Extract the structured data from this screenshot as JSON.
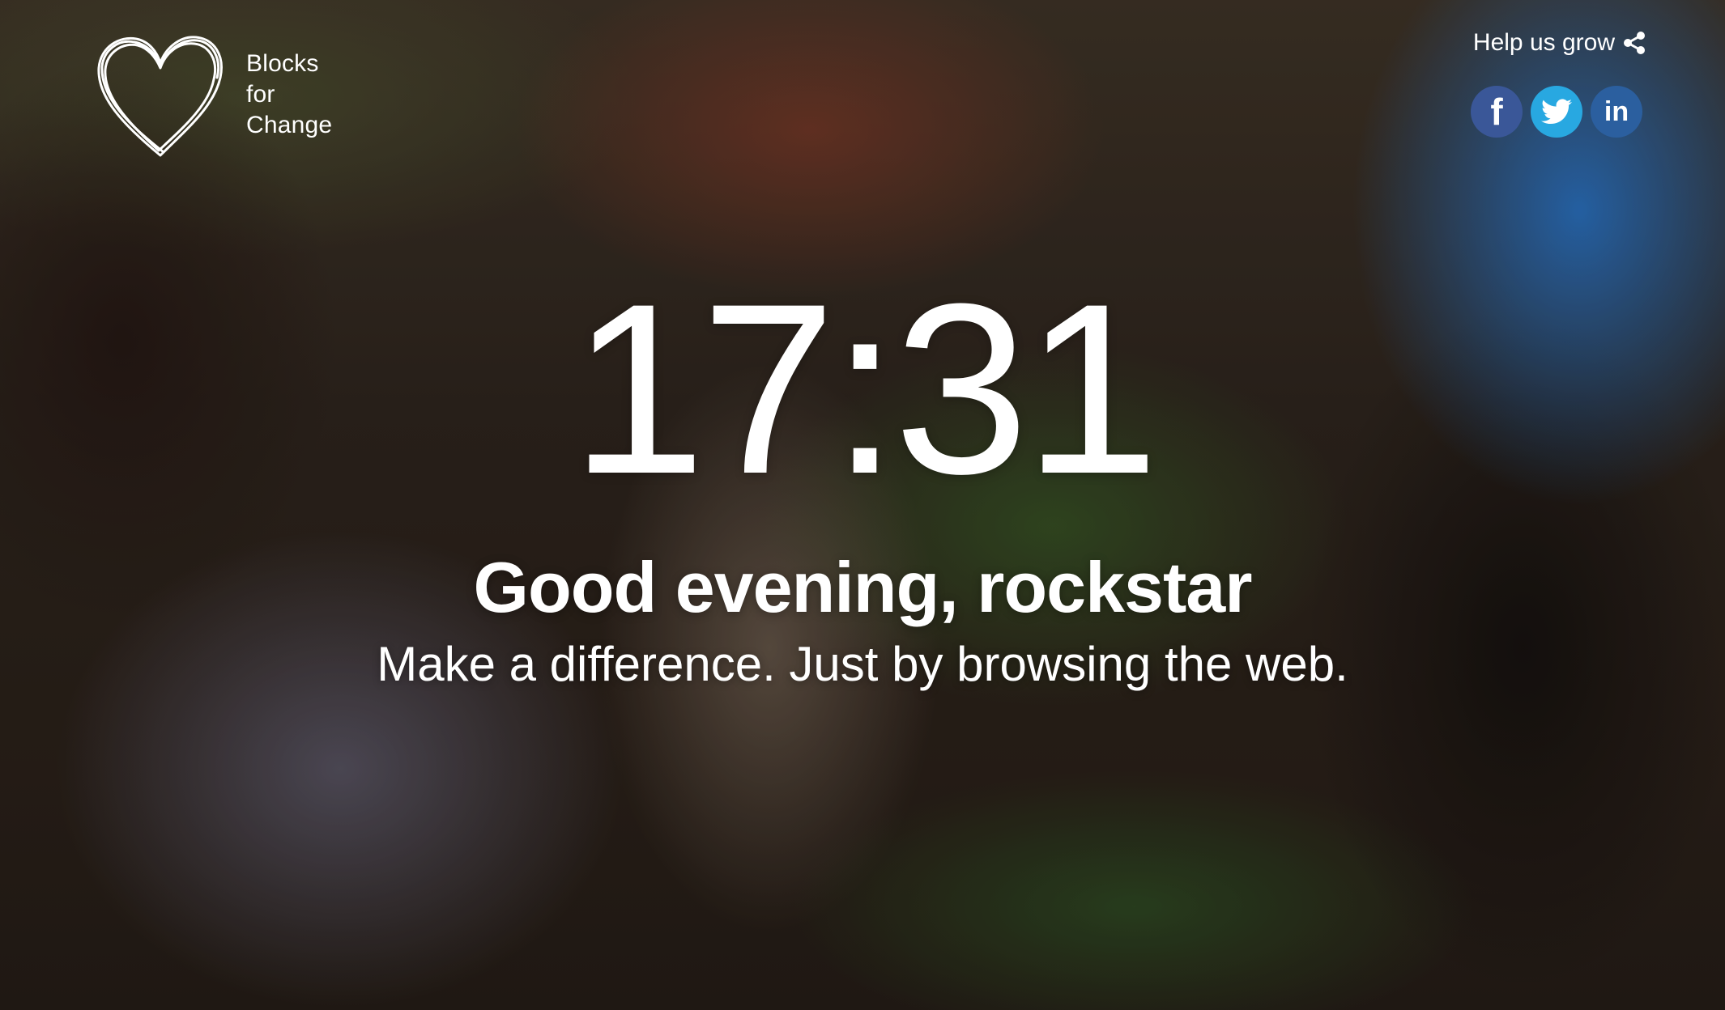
{
  "logo": {
    "lines": [
      "Blocks",
      "for",
      "Change"
    ]
  },
  "header": {
    "help_label": "Help us grow",
    "share_icon": "share-icon",
    "social": [
      {
        "name": "facebook",
        "glyph": "f",
        "color": "#3a5798"
      },
      {
        "name": "twitter",
        "glyph": "twitter-bird",
        "color": "#28a8e1"
      },
      {
        "name": "linkedin",
        "glyph": "in",
        "color": "#2b5f9f"
      }
    ]
  },
  "main": {
    "time": "17:31",
    "greeting": "Good evening, rockstar",
    "tagline": "Make a difference. Just by browsing the web."
  }
}
